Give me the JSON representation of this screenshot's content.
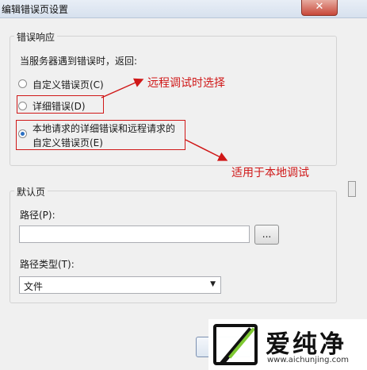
{
  "window": {
    "title": "编辑错误页设置",
    "close_glyph": "✕"
  },
  "error_response": {
    "legend": "错误响应",
    "prompt": "当服务器遇到错误时，返回:",
    "options": [
      {
        "label": "自定义错误页(C)",
        "checked": false
      },
      {
        "label": "详细错误(D)",
        "checked": false
      },
      {
        "label_line1": "本地请求的详细错误和远程请求的",
        "label_line2": "自定义错误页(E)",
        "checked": true
      }
    ]
  },
  "annotations": {
    "remote": "远程调试时选择",
    "local": "适用于本地调试",
    "color": "#d01818"
  },
  "default_page": {
    "legend": "默认页",
    "path_label": "路径(P):",
    "path_value": "",
    "browse_label": "...",
    "path_type_label": "路径类型(T):",
    "path_type_value": "文件"
  },
  "watermark": {
    "name": "爱纯净",
    "url": "www.aichunjing.com"
  }
}
